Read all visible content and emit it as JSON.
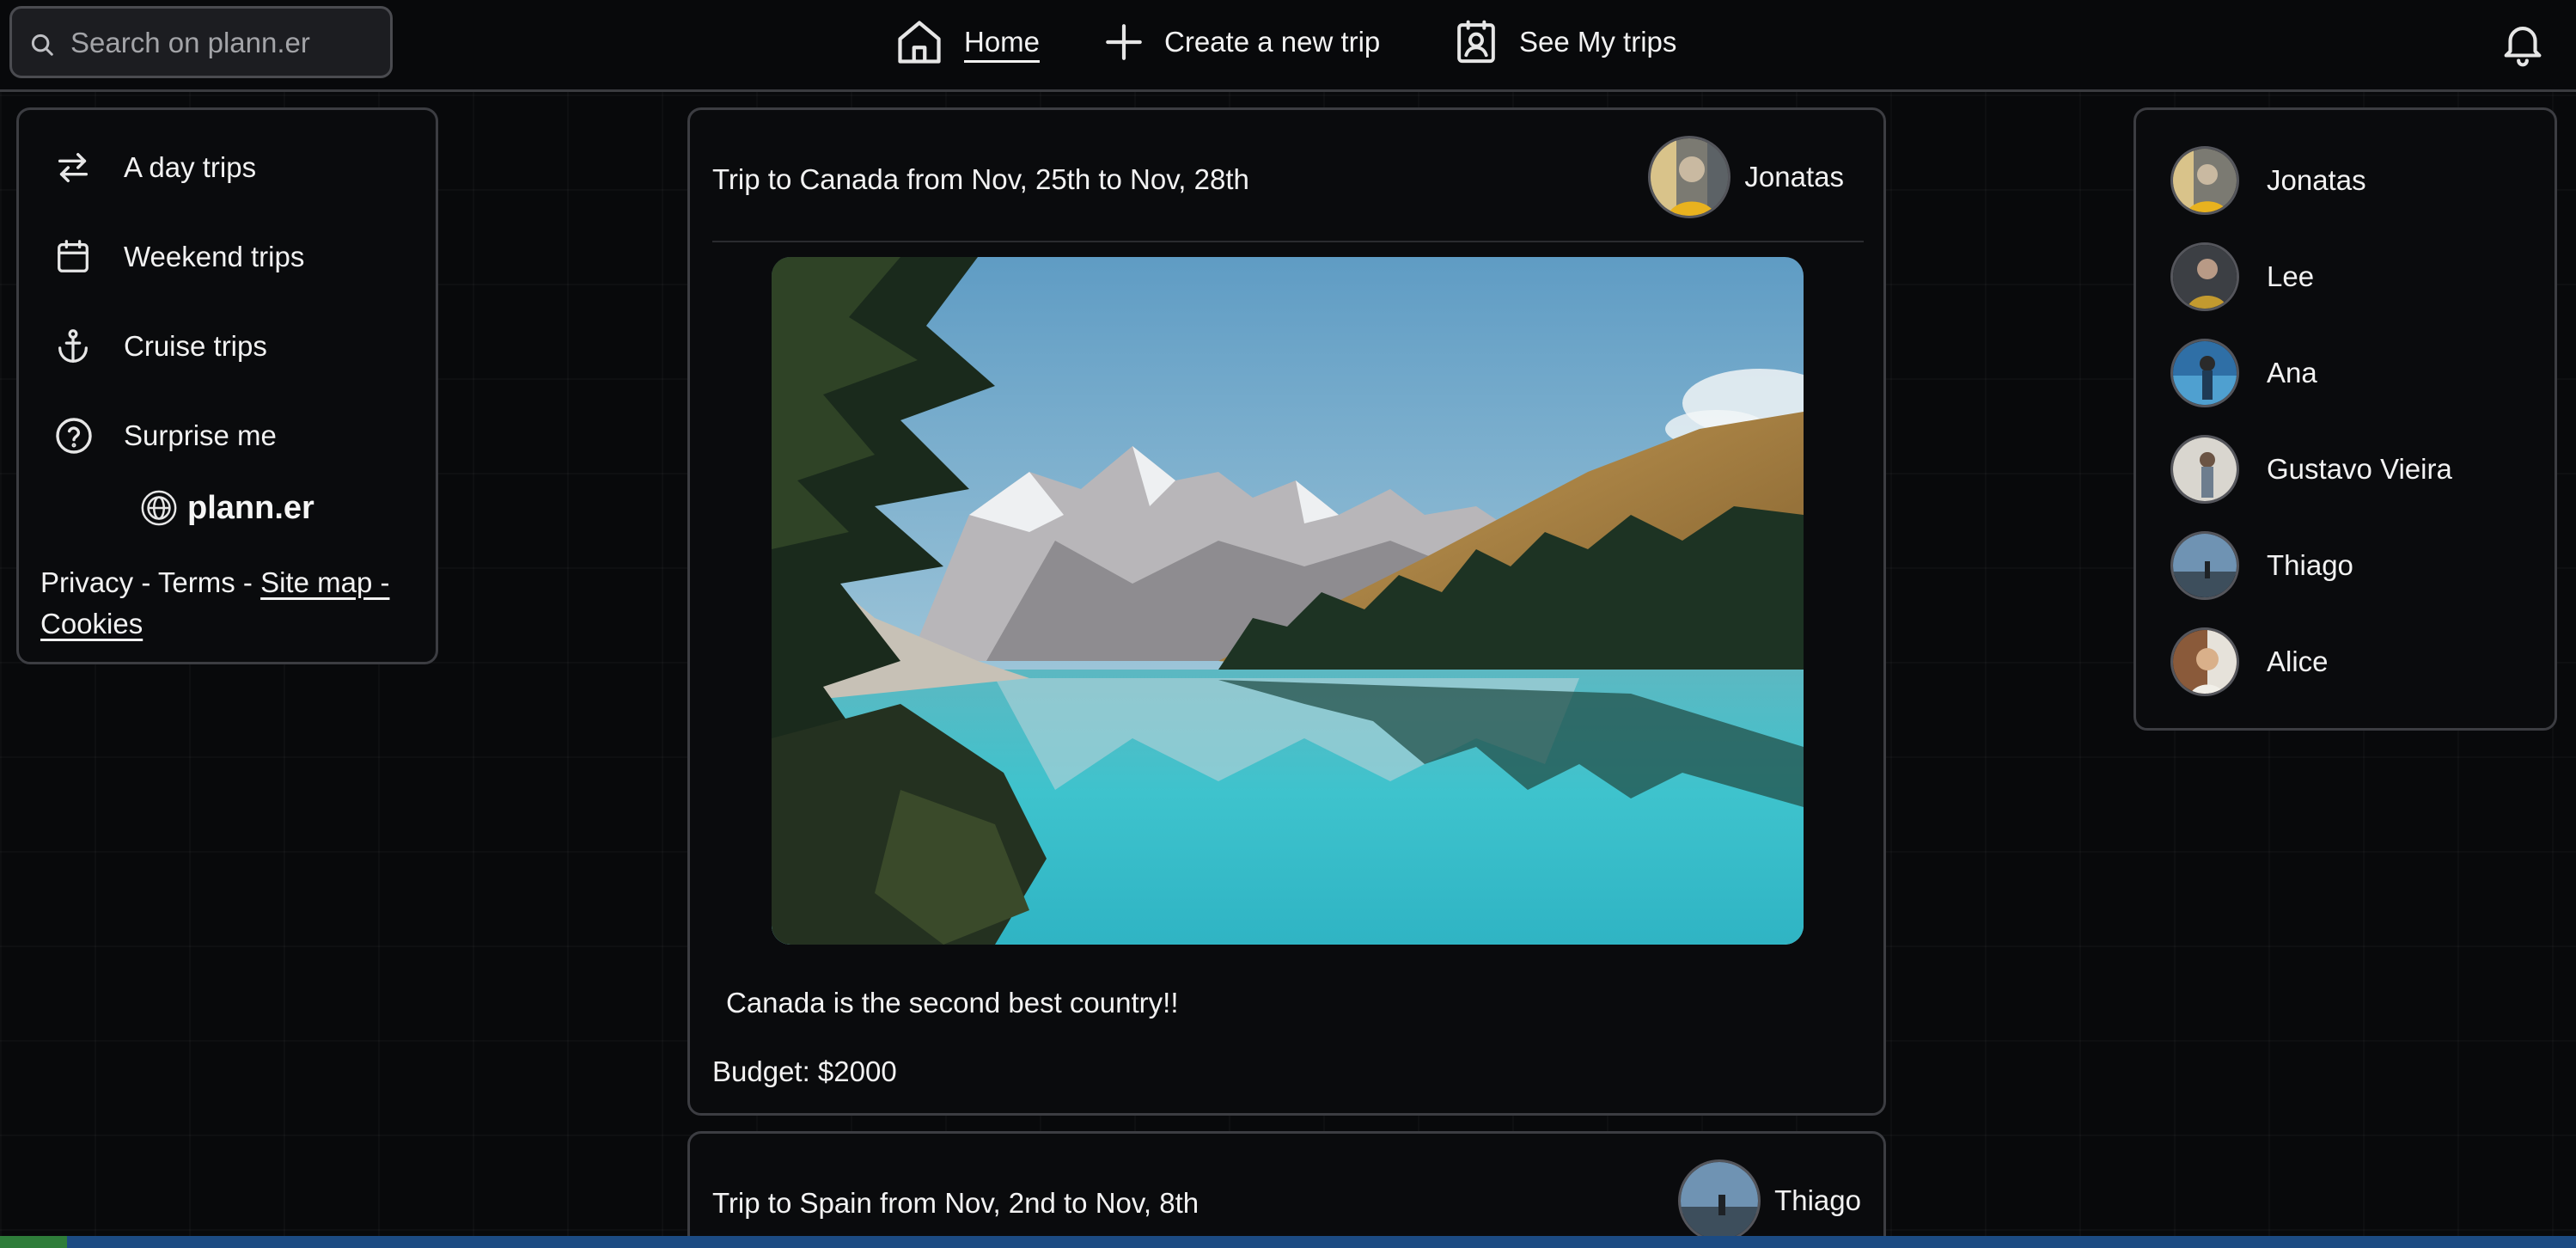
{
  "search": {
    "placeholder": "Search on plann.er"
  },
  "nav": {
    "home": "Home",
    "create": "Create a new trip",
    "my_trips": "See My trips"
  },
  "left_menu": {
    "items": [
      {
        "label": "A day trips",
        "icon": "arrows-swap-icon"
      },
      {
        "label": "Weekend trips",
        "icon": "calendar-icon"
      },
      {
        "label": "Cruise trips",
        "icon": "anchor-icon"
      },
      {
        "label": "Surprise me",
        "icon": "question-circle-icon"
      }
    ],
    "brand": "plann.er",
    "footer": {
      "privacy": "Privacy",
      "sep1": " - ",
      "terms": "Terms",
      "sep2": " - ",
      "sitemap": "Site map -",
      "cookies": "Cookies"
    }
  },
  "feed": [
    {
      "title": "Trip to Canada from Nov, 25th to Nov, 28th",
      "author": "Jonatas",
      "caption": "Canada is the second best country!!",
      "budget": "Budget: $2000"
    },
    {
      "title": "Trip to Spain from Nov, 2nd to Nov, 8th",
      "author": "Thiago"
    }
  ],
  "friends": [
    {
      "name": "Jonatas"
    },
    {
      "name": "Lee"
    },
    {
      "name": "Ana"
    },
    {
      "name": "Gustavo Vieira"
    },
    {
      "name": "Thiago"
    },
    {
      "name": "Alice"
    }
  ],
  "colors": {
    "background": "#08090b",
    "panel_border": "#3c3d42",
    "text": "#f2f2f2",
    "statusbar": "#1c4b83"
  }
}
